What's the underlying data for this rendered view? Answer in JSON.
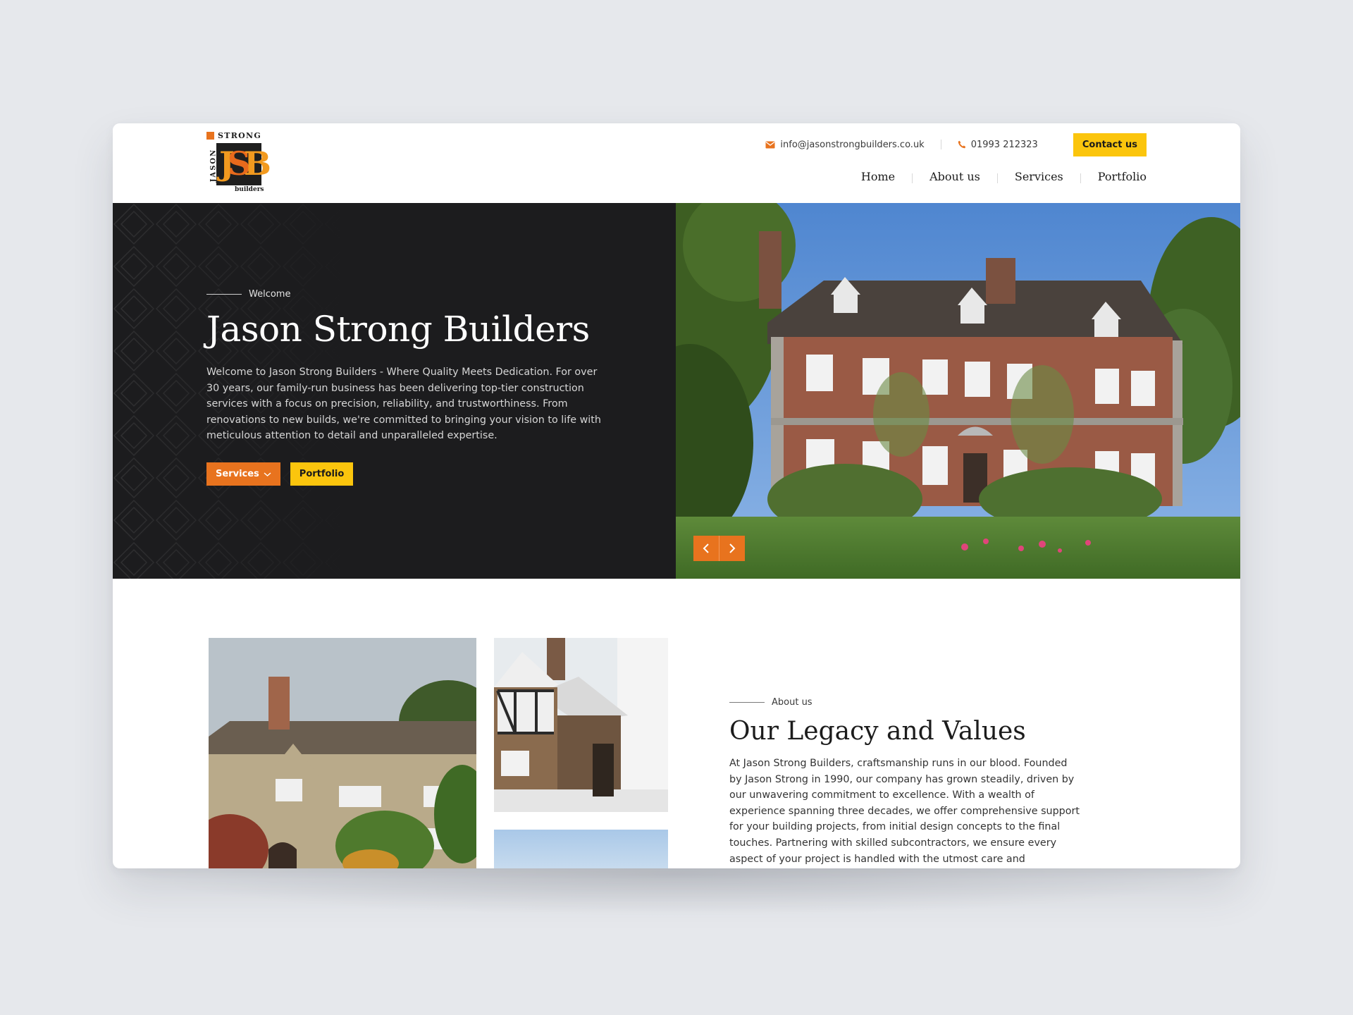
{
  "brand": {
    "logo_top": "STRONG",
    "logo_side": "JASON",
    "logo_initials_1": "J",
    "logo_initials_2": "S",
    "logo_initials_3": "B",
    "logo_bottom": "builders",
    "accent_color": "#e8731e",
    "yellow_color": "#fbc50d"
  },
  "topbar": {
    "email": "info@jasonstrongbuilders.co.uk",
    "email_icon": "mail-icon",
    "phone": "01993 212323",
    "phone_icon": "phone-icon",
    "contact_button": "Contact us"
  },
  "nav": {
    "items": [
      {
        "label": "Home",
        "active": true
      },
      {
        "label": "About us",
        "active": false
      },
      {
        "label": "Services",
        "active": false
      },
      {
        "label": "Portfolio",
        "active": false
      }
    ]
  },
  "hero": {
    "eyebrow": "Welcome",
    "title": "Jason Strong Builders",
    "description": "Welcome to Jason Strong Builders - Where Quality Meets Dedication. For over 30 years, our family-run business has been delivering top-tier construction services with a focus on precision, reliability, and  trustworthiness. From renovations to new builds, we're committed to bringing your vision to life with meticulous attention to detail and unparalleled expertise.",
    "services_button": "Services",
    "portfolio_button": "Portfolio",
    "prev_icon": "chevron-left-icon",
    "next_icon": "chevron-right-icon"
  },
  "about": {
    "eyebrow": "About us",
    "title": "Our Legacy and Values",
    "description": "At Jason Strong Builders, craftsmanship runs in our blood. Founded by Jason Strong in 1990, our company has grown steadily, driven by our unwavering commitment to excellence. With a wealth of experience spanning three decades, we offer comprehensive support for your building  projects, from initial design concepts to the final touches. Partnering with skilled subcontractors, we ensure every aspect of your project is handled with the utmost care and professionalism."
  }
}
